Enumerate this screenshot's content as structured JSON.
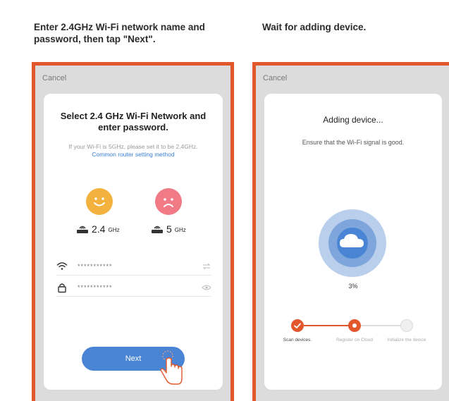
{
  "captions": {
    "left": "Enter 2.4GHz Wi-Fi network name and password, then tap \"Next\".",
    "right": "Wait for adding device."
  },
  "screen_wifi": {
    "cancel_label": "Cancel",
    "title": "Select 2.4 GHz Wi-Fi Network and enter password.",
    "hint_text": "If your Wi-Fi is 5GHz, please set it to be 2.4GHz.",
    "hint_link": "Common router setting method",
    "band_24_main": "2.4",
    "band_24_unit": "GHz",
    "band_5_main": "5",
    "band_5_unit": "GHz",
    "wifi_name_value": "***********",
    "password_value": "***********",
    "next_label": "Next",
    "icons": {
      "happy": "happy-face-icon",
      "sad": "sad-face-icon",
      "router": "router-icon",
      "wifi": "wifi-icon",
      "lock": "lock-icon",
      "swap": "swap-icon",
      "eye": "eye-icon",
      "hand": "tap-hand-icon"
    }
  },
  "screen_adding": {
    "cancel_label": "Cancel",
    "title": "Adding device...",
    "subtitle": "Ensure that the Wi-Fi signal is good.",
    "progress_percent": "3%",
    "progress_value": 3,
    "steps": [
      {
        "label": "Scan devices.",
        "state": "done"
      },
      {
        "label": "Register on Cloud",
        "state": "active"
      },
      {
        "label": "Initialize the device",
        "state": "pending"
      }
    ],
    "icons": {
      "cloud": "cloud-icon",
      "check": "check-icon"
    }
  },
  "colors": {
    "accent": "#e2572b",
    "button_blue": "#4a84d4",
    "happy_face": "#f3b23e",
    "sad_face": "#f07a85",
    "progress_ring_outer": "#b9cfeb",
    "progress_ring_inner": "#7fa6dc",
    "progress_core": "#4a84d4"
  }
}
